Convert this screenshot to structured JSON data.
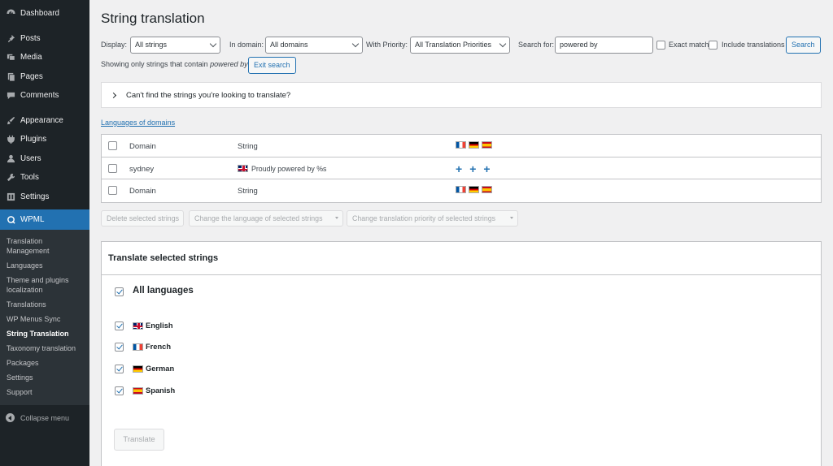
{
  "sidebar": {
    "menu": [
      {
        "label": "Dashboard",
        "icon": "dashboard-icon"
      },
      {
        "label": "Posts",
        "icon": "pin-icon"
      },
      {
        "label": "Media",
        "icon": "media-icon"
      },
      {
        "label": "Pages",
        "icon": "pages-icon"
      },
      {
        "label": "Comments",
        "icon": "comment-icon"
      },
      {
        "label": "Appearance",
        "icon": "brush-icon"
      },
      {
        "label": "Plugins",
        "icon": "plugin-icon"
      },
      {
        "label": "Users",
        "icon": "user-icon"
      },
      {
        "label": "Tools",
        "icon": "wrench-icon"
      },
      {
        "label": "Settings",
        "icon": "settings-icon"
      }
    ],
    "active": {
      "label": "WPML",
      "icon": "wpml-icon"
    },
    "submenu": [
      "Translation Management",
      "Languages",
      "Theme and plugins localization",
      "Translations",
      "WP Menus Sync",
      "String Translation",
      "Taxonomy translation",
      "Packages",
      "Settings",
      "Support"
    ],
    "current_sub": "String Translation",
    "collapse_label": "Collapse menu"
  },
  "page": {
    "title": "String translation"
  },
  "filters": {
    "display_label": "Display:",
    "display_value": "All strings",
    "domain_label": "In domain:",
    "domain_value": "All domains",
    "priority_label": "With Priority:",
    "priority_value": "All Translation Priorities",
    "search_label": "Search for:",
    "search_value": "powered by",
    "exact_match_label": "Exact match",
    "include_translations_label": "Include translations",
    "search_button": "Search"
  },
  "showing": {
    "prefix": "Showing only strings that contain",
    "term": "powered by",
    "exit_button": "Exit search"
  },
  "cant_find": "Can't find the strings you're looking to translate?",
  "languages_of_domains_link": "Languages of domains",
  "table": {
    "header": {
      "domain": "Domain",
      "string": "String",
      "flags": [
        "fr",
        "de",
        "es"
      ]
    },
    "rows": [
      {
        "domain": "sydney",
        "string": "Proudly powered by %s",
        "source_flag": "en"
      }
    ],
    "footer": {
      "domain": "Domain",
      "string": "String",
      "flags": [
        "fr",
        "de",
        "es"
      ]
    },
    "add_symbol": "+"
  },
  "bulk": {
    "delete": "Delete selected strings",
    "change_language": "Change the language of selected strings",
    "change_priority": "Change translation priority of selected strings"
  },
  "translate_panel": {
    "heading": "Translate selected strings",
    "all_languages": "All languages",
    "languages": [
      {
        "name": "English",
        "flag": "en",
        "checked": true
      },
      {
        "name": "French",
        "flag": "fr",
        "checked": true
      },
      {
        "name": "German",
        "flag": "de",
        "checked": true
      },
      {
        "name": "Spanish",
        "flag": "es",
        "checked": true
      }
    ],
    "translate_button": "Translate"
  },
  "colors": {
    "sidebar_bg": "#1d2327",
    "accent": "#2271b1",
    "page_bg": "#f0f0f1"
  }
}
